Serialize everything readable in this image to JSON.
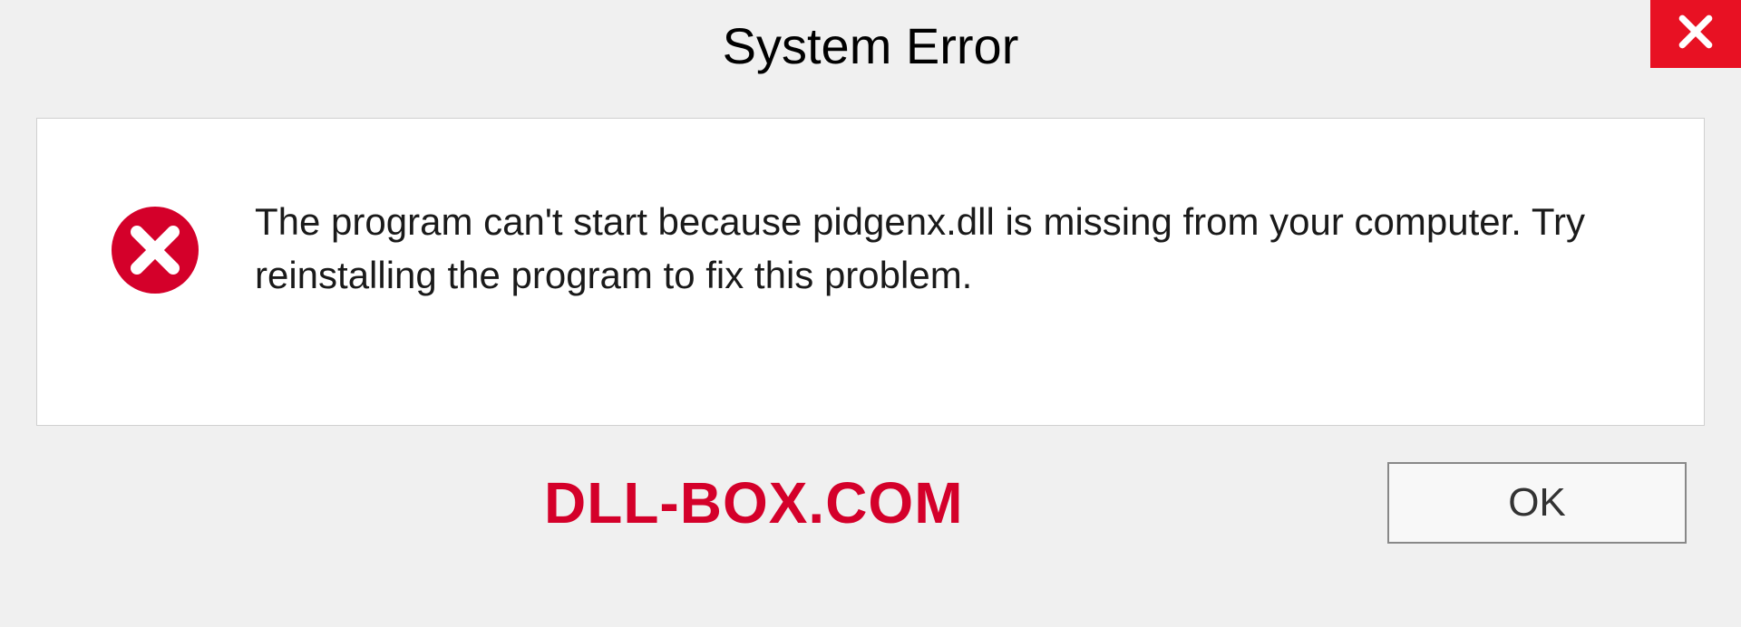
{
  "title": "System Error",
  "message": "The program can't start because pidgenx.dll is missing from your computer. Try reinstalling the program to fix this problem.",
  "watermark": "DLL-BOX.COM",
  "buttons": {
    "ok": "OK"
  }
}
